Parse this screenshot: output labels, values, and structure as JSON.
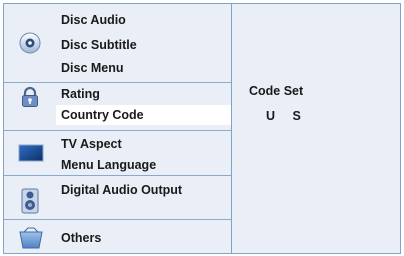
{
  "menu": {
    "disc": {
      "icon": "disc-icon",
      "items": [
        "Disc Audio",
        "Disc Subtitle",
        "Disc Menu"
      ]
    },
    "lock": {
      "icon": "lock-icon",
      "items": [
        "Rating",
        "Country Code"
      ]
    },
    "tv": {
      "icon": "tv-screen-icon",
      "items": [
        "TV Aspect",
        "Menu Language"
      ]
    },
    "speaker": {
      "icon": "speaker-icon",
      "items": [
        "Digital Audio Output"
      ]
    },
    "others": {
      "icon": "box-icon",
      "items": [
        "Others"
      ]
    },
    "selected": "Country Code"
  },
  "detail": {
    "label": "Code Set",
    "value": "U S"
  },
  "colors": {
    "background": "#e9eef7",
    "border": "#7fa3c9",
    "selected_row": "#ffffff"
  }
}
